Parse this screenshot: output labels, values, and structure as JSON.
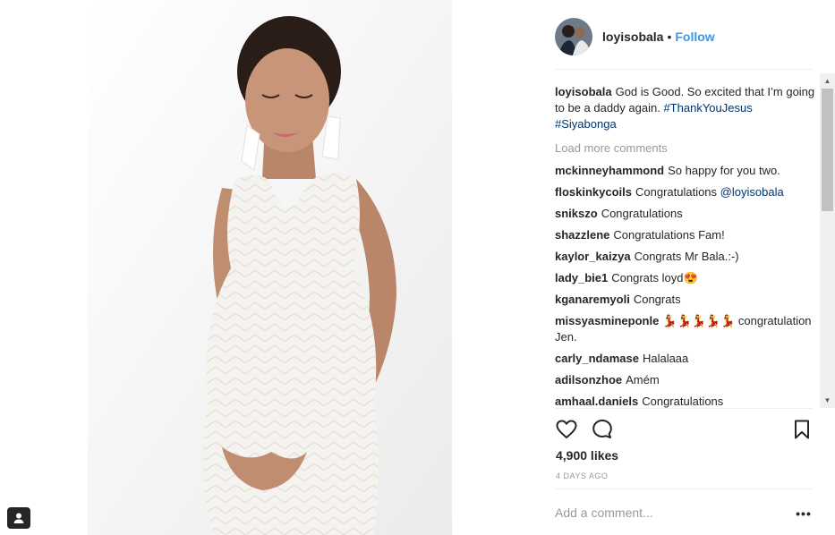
{
  "post": {
    "author": "loyisobala",
    "follow_label": "Follow",
    "separator": "•"
  },
  "caption": {
    "user": "loyisobala",
    "text": "God is Good. So excited that I’m going to be a daddy again.",
    "hashtags": [
      "#ThankYouJesus",
      "#Siyabonga"
    ]
  },
  "load_more": "Load more comments",
  "comments": [
    {
      "user": "mckinneyhammond",
      "text": "So happy for you two."
    },
    {
      "user": "floskinkycoils",
      "text": "Congratulations",
      "mention": "@loyisobala"
    },
    {
      "user": "snikszo",
      "text": "Congratulations"
    },
    {
      "user": "shazzlene",
      "text": "Congratulations Fam!"
    },
    {
      "user": "kaylor_kaizya",
      "text": "Congrats Mr Bala.:-)"
    },
    {
      "user": "lady_bie1",
      "text": "Congrats loyd😍"
    },
    {
      "user": "kganaremyoli",
      "text": "Congrats"
    },
    {
      "user": "missyasmineponle",
      "text": "💃💃💃💃💃 congratulation Jen."
    },
    {
      "user": "carly_ndamase",
      "text": "Halalaaa"
    },
    {
      "user": "adilsonzhoe",
      "text": "Amém"
    },
    {
      "user": "amhaal.daniels",
      "text": "Congratulations"
    }
  ],
  "likes": "4,900 likes",
  "timestamp": "4 DAYS AGO",
  "add_comment": {
    "placeholder": "Add a comment..."
  },
  "more_label": "•••",
  "icons": {
    "like": "heart-icon",
    "comment": "comment-bubble-icon",
    "save": "bookmark-icon",
    "tag": "user-tag-icon",
    "more": "more-options-icon"
  },
  "colors": {
    "link": "#3897f0",
    "hashtag": "#003569",
    "muted": "#999999",
    "text": "#262626",
    "dress": "#f5f3ef"
  }
}
